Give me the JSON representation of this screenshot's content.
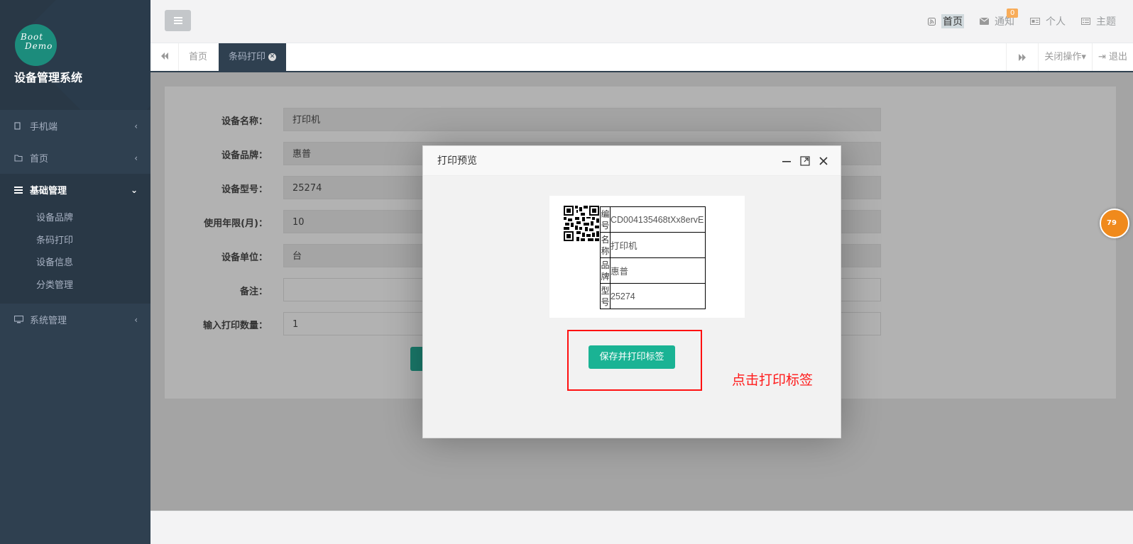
{
  "sidebar": {
    "logo_line1": "Boot",
    "logo_line2": "Demo",
    "app_name": "设备管理系统",
    "items": [
      {
        "label": "手机端",
        "icon": "square-icon"
      },
      {
        "label": "首页",
        "icon": "folder-icon"
      },
      {
        "label": "基础管理",
        "icon": "list-icon",
        "expanded": true,
        "children": [
          "设备品牌",
          "条码打印",
          "设备信息",
          "分类管理"
        ]
      },
      {
        "label": "系统管理",
        "icon": "desktop-icon"
      }
    ]
  },
  "topbar": {
    "links": [
      {
        "label": "首页",
        "icon": "rss-icon"
      },
      {
        "label": "通知",
        "icon": "envelope-icon",
        "badge": "0"
      },
      {
        "label": "个人",
        "icon": "id-card-icon"
      },
      {
        "label": "主题",
        "icon": "list-alt-icon"
      }
    ]
  },
  "tabs": {
    "home": "首页",
    "active": "条码打印",
    "close_ops": "关闭操作",
    "logout": "退出"
  },
  "form": {
    "rows": [
      {
        "label": "设备名称：",
        "value": "打印机"
      },
      {
        "label": "设备品牌：",
        "value": "惠普"
      },
      {
        "label": "设备型号：",
        "value": "25274"
      },
      {
        "label": "使用年限(月)：",
        "value": "10"
      },
      {
        "label": "设备单位：",
        "value": "台"
      },
      {
        "label": "备注：",
        "value": ""
      },
      {
        "label": "输入打印数量：",
        "value": "1"
      }
    ]
  },
  "modal": {
    "title": "打印预览",
    "label_rows": [
      {
        "key": "编号",
        "value": "CD004135468tXx8ervE"
      },
      {
        "key": "名称",
        "value": "打印机"
      },
      {
        "key": "品牌",
        "value": "惠普"
      },
      {
        "key": "型号",
        "value": "25274"
      }
    ],
    "print_button": "保存并打印标签",
    "hint": "点击打印标签"
  },
  "floating_badge": "79",
  "colors": {
    "sidebar_bg": "#2f4050",
    "primary": "#1ab394",
    "annotation_red": "#ff1010",
    "badge_orange": "#f8ac59"
  }
}
